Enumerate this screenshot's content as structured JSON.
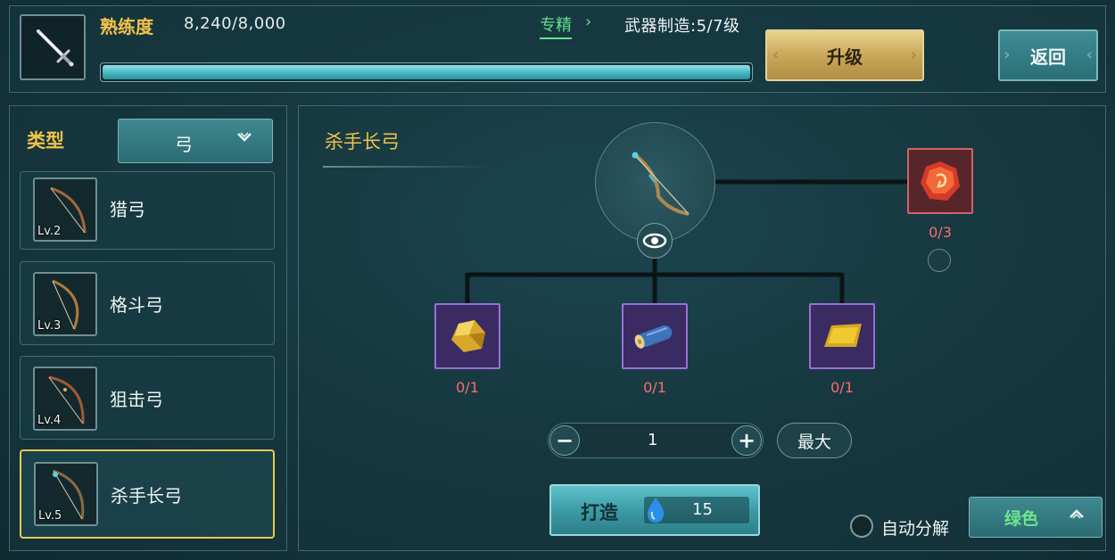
{
  "header": {
    "proficiency_label": "熟练度",
    "proficiency_value": "8,240/8,000",
    "proficiency_progress": 1.0,
    "specialize_link": "专精",
    "specialize_arrow": "›",
    "weapon_craft_level": "武器制造:5/7级",
    "upgrade_button": "升级",
    "back_button": "返回",
    "weapon_icon": "sword-icon"
  },
  "sidebar": {
    "type_label": "类型",
    "type_selected": "弓",
    "type_chevron": "chevron-down-icon",
    "items": [
      {
        "name": "猎弓",
        "level": "Lv.2",
        "selected": false
      },
      {
        "name": "格斗弓",
        "level": "Lv.3",
        "selected": false
      },
      {
        "name": "狙击弓",
        "level": "Lv.4",
        "selected": false
      },
      {
        "name": "杀手长弓",
        "level": "Lv.5",
        "selected": true
      }
    ]
  },
  "recipe": {
    "title": "杀手长弓",
    "product_icon": "bow-icon",
    "preview_icon": "eye-icon",
    "materials": [
      {
        "icon": "gold-ore-icon",
        "count": "0/1"
      },
      {
        "icon": "wood-log-icon",
        "count": "0/1"
      },
      {
        "icon": "leather-icon",
        "count": "0/1"
      }
    ],
    "gem": {
      "icon": "red-gem-icon",
      "count": "0/3"
    }
  },
  "quantity": {
    "minus": "−",
    "value": "1",
    "plus": "+",
    "max_button": "最大"
  },
  "forge": {
    "label": "打造",
    "cost_icon": "water-drop-icon",
    "cost": "15"
  },
  "auto_decompose": {
    "label": "自动分解",
    "checked": false,
    "quality": "绿色",
    "quality_chevron": "chevron-up-icon"
  },
  "colors": {
    "gold_text": "#f0c24a",
    "missing_count": "#ff6b6b",
    "green_quality": "#6ee58f",
    "rare_border": "#9b6ed8"
  }
}
